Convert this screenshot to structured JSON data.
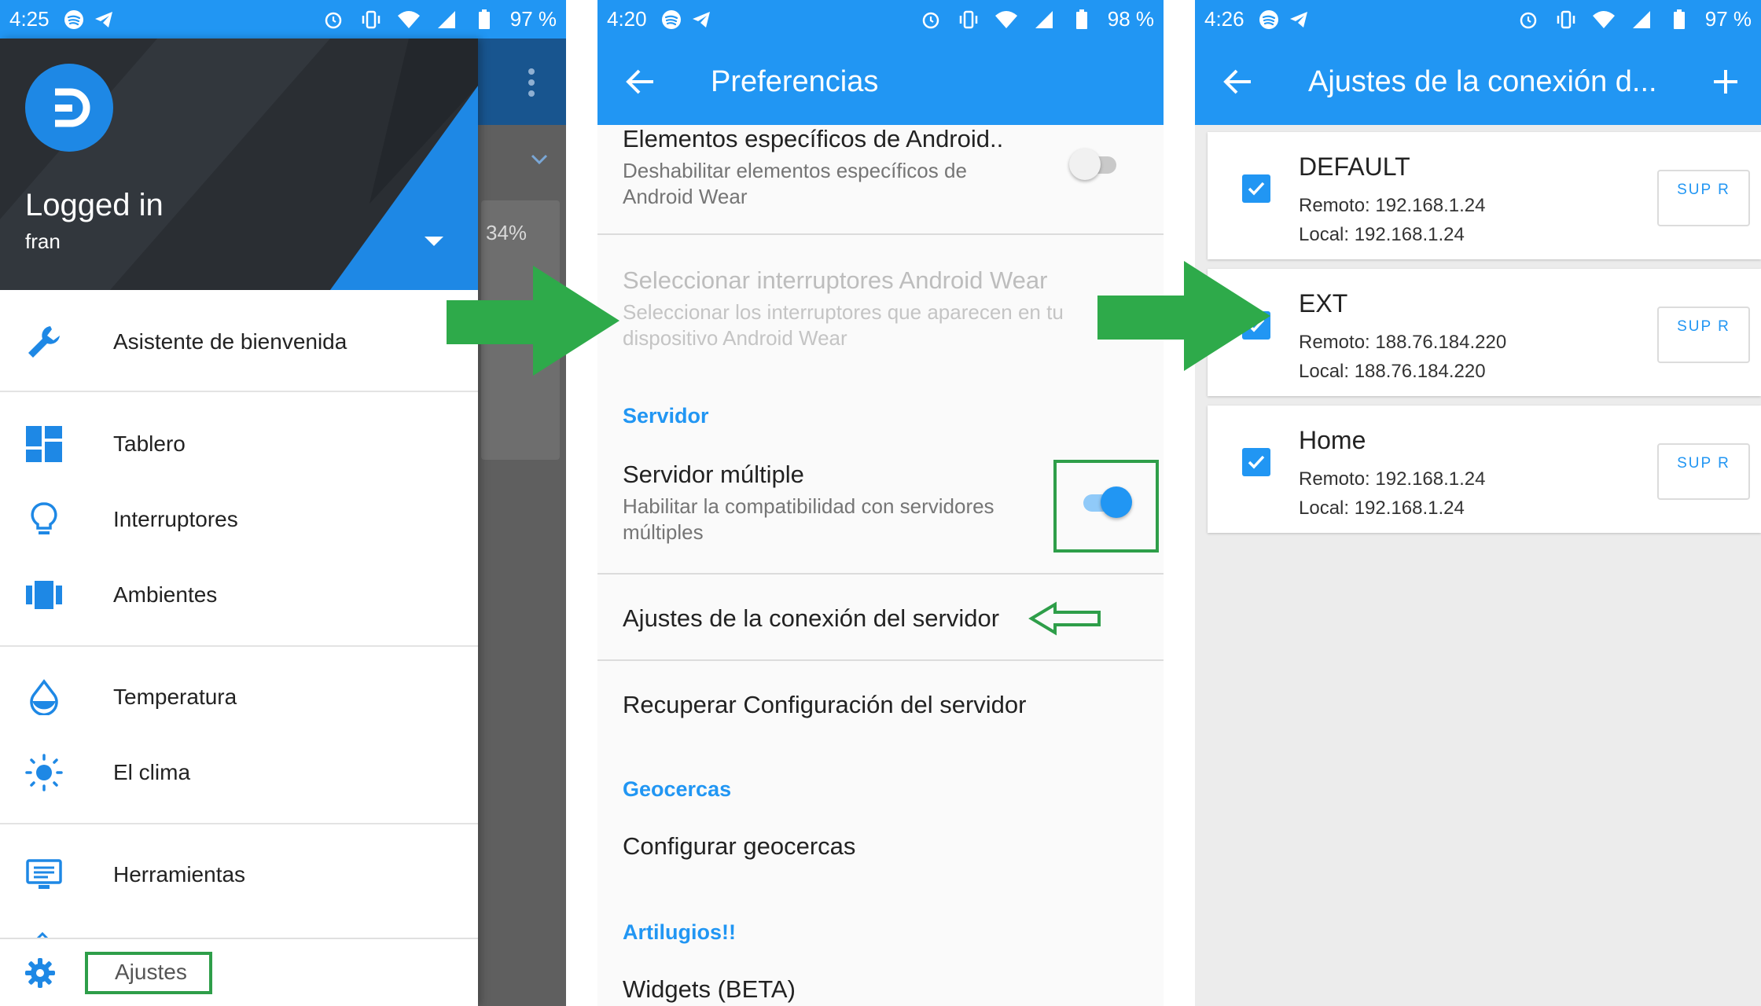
{
  "colors": {
    "accent": "#2196f3",
    "highlight": "#2e9e49",
    "drawer_header": "#2a2e33"
  },
  "panel1": {
    "status": {
      "time": "4:25",
      "battery": "97 %"
    },
    "header": {
      "name": "Logged in",
      "user": "fran"
    },
    "behind": {
      "percent": "34%"
    },
    "nav": [
      {
        "label": "Asistente de bienvenida",
        "icon": "wrench-icon"
      },
      {
        "label": "Tablero",
        "icon": "dashboard-icon"
      },
      {
        "label": "Interruptores",
        "icon": "lightbulb-icon"
      },
      {
        "label": "Ambientes",
        "icon": "scenes-icon"
      },
      {
        "label": "Temperatura",
        "icon": "drop-icon"
      },
      {
        "label": "El clima",
        "icon": "sun-icon"
      },
      {
        "label": "Herramientas",
        "icon": "tools-icon"
      }
    ],
    "settings_label": "Ajustes"
  },
  "panel2": {
    "status": {
      "time": "4:20",
      "battery": "98 %"
    },
    "title": "Preferencias",
    "items": {
      "android_wear": {
        "title": "Elementos específicos de Android..",
        "summary": "Deshabilitar elementos específicos de Android Wear",
        "enabled": false
      },
      "wear_switches": {
        "title": "Seleccionar interruptores Android Wear",
        "summary": "Seleccionar los interruptores que aparecen en tu dispositivo Android Wear"
      },
      "multi_server": {
        "title": "Servidor múltiple",
        "summary": "Habilitar la compatibilidad con servidores múltiples",
        "enabled": true
      },
      "connection": {
        "title": "Ajustes de la conexión del servidor"
      },
      "recover": {
        "title": "Recuperar Configuración del servidor"
      },
      "geofences": {
        "title": "Configurar geocercas"
      },
      "widgets": {
        "title": "Widgets (BETA)"
      }
    },
    "categories": {
      "server": "Servidor",
      "geofences": "Geocercas",
      "gadgets": "Artilugios!!"
    }
  },
  "panel3": {
    "status": {
      "time": "4:26",
      "battery": "97 %"
    },
    "title": "Ajustes de la conexión d...",
    "delete_label": "SUP R",
    "servers": [
      {
        "name": "DEFAULT",
        "remote": "Remoto: 192.168.1.24",
        "local": "Local: 192.168.1.24",
        "checked": true
      },
      {
        "name": "EXT",
        "remote": "Remoto: 188.76.184.220",
        "local": "Local: 188.76.184.220",
        "checked": true
      },
      {
        "name": "Home",
        "remote": "Remoto: 192.168.1.24",
        "local": "Local: 192.168.1.24",
        "checked": true
      }
    ]
  }
}
